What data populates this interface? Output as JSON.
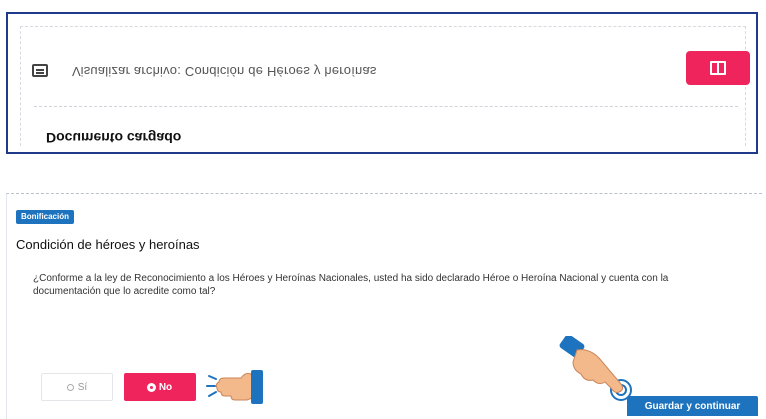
{
  "document_card": {
    "view_file_text": "Visualizar archivo: Condición de Héroes y heroínas",
    "title": "Documento cargado",
    "view_button_icon": "book-icon",
    "file_icon": "file-icon"
  },
  "bonificacion": {
    "badge": "Bonificación",
    "title": "Condición de héroes y heroínas",
    "question": "¿Conforme a la ley de Reconocimiento a los Héroes y Heroínas Nacionales, usted ha sido declarado Héroe o Heroína Nacional y cuenta con la documentación que lo acredite como tal?",
    "options": [
      {
        "label": "Sí",
        "selected": false
      },
      {
        "label": "No",
        "selected": true
      }
    ],
    "save_button": "Guardar y continuar"
  },
  "colors": {
    "accent_pink": "#f0245c",
    "primary_blue": "#1e73be",
    "frame_blue": "#1f3a8a"
  }
}
